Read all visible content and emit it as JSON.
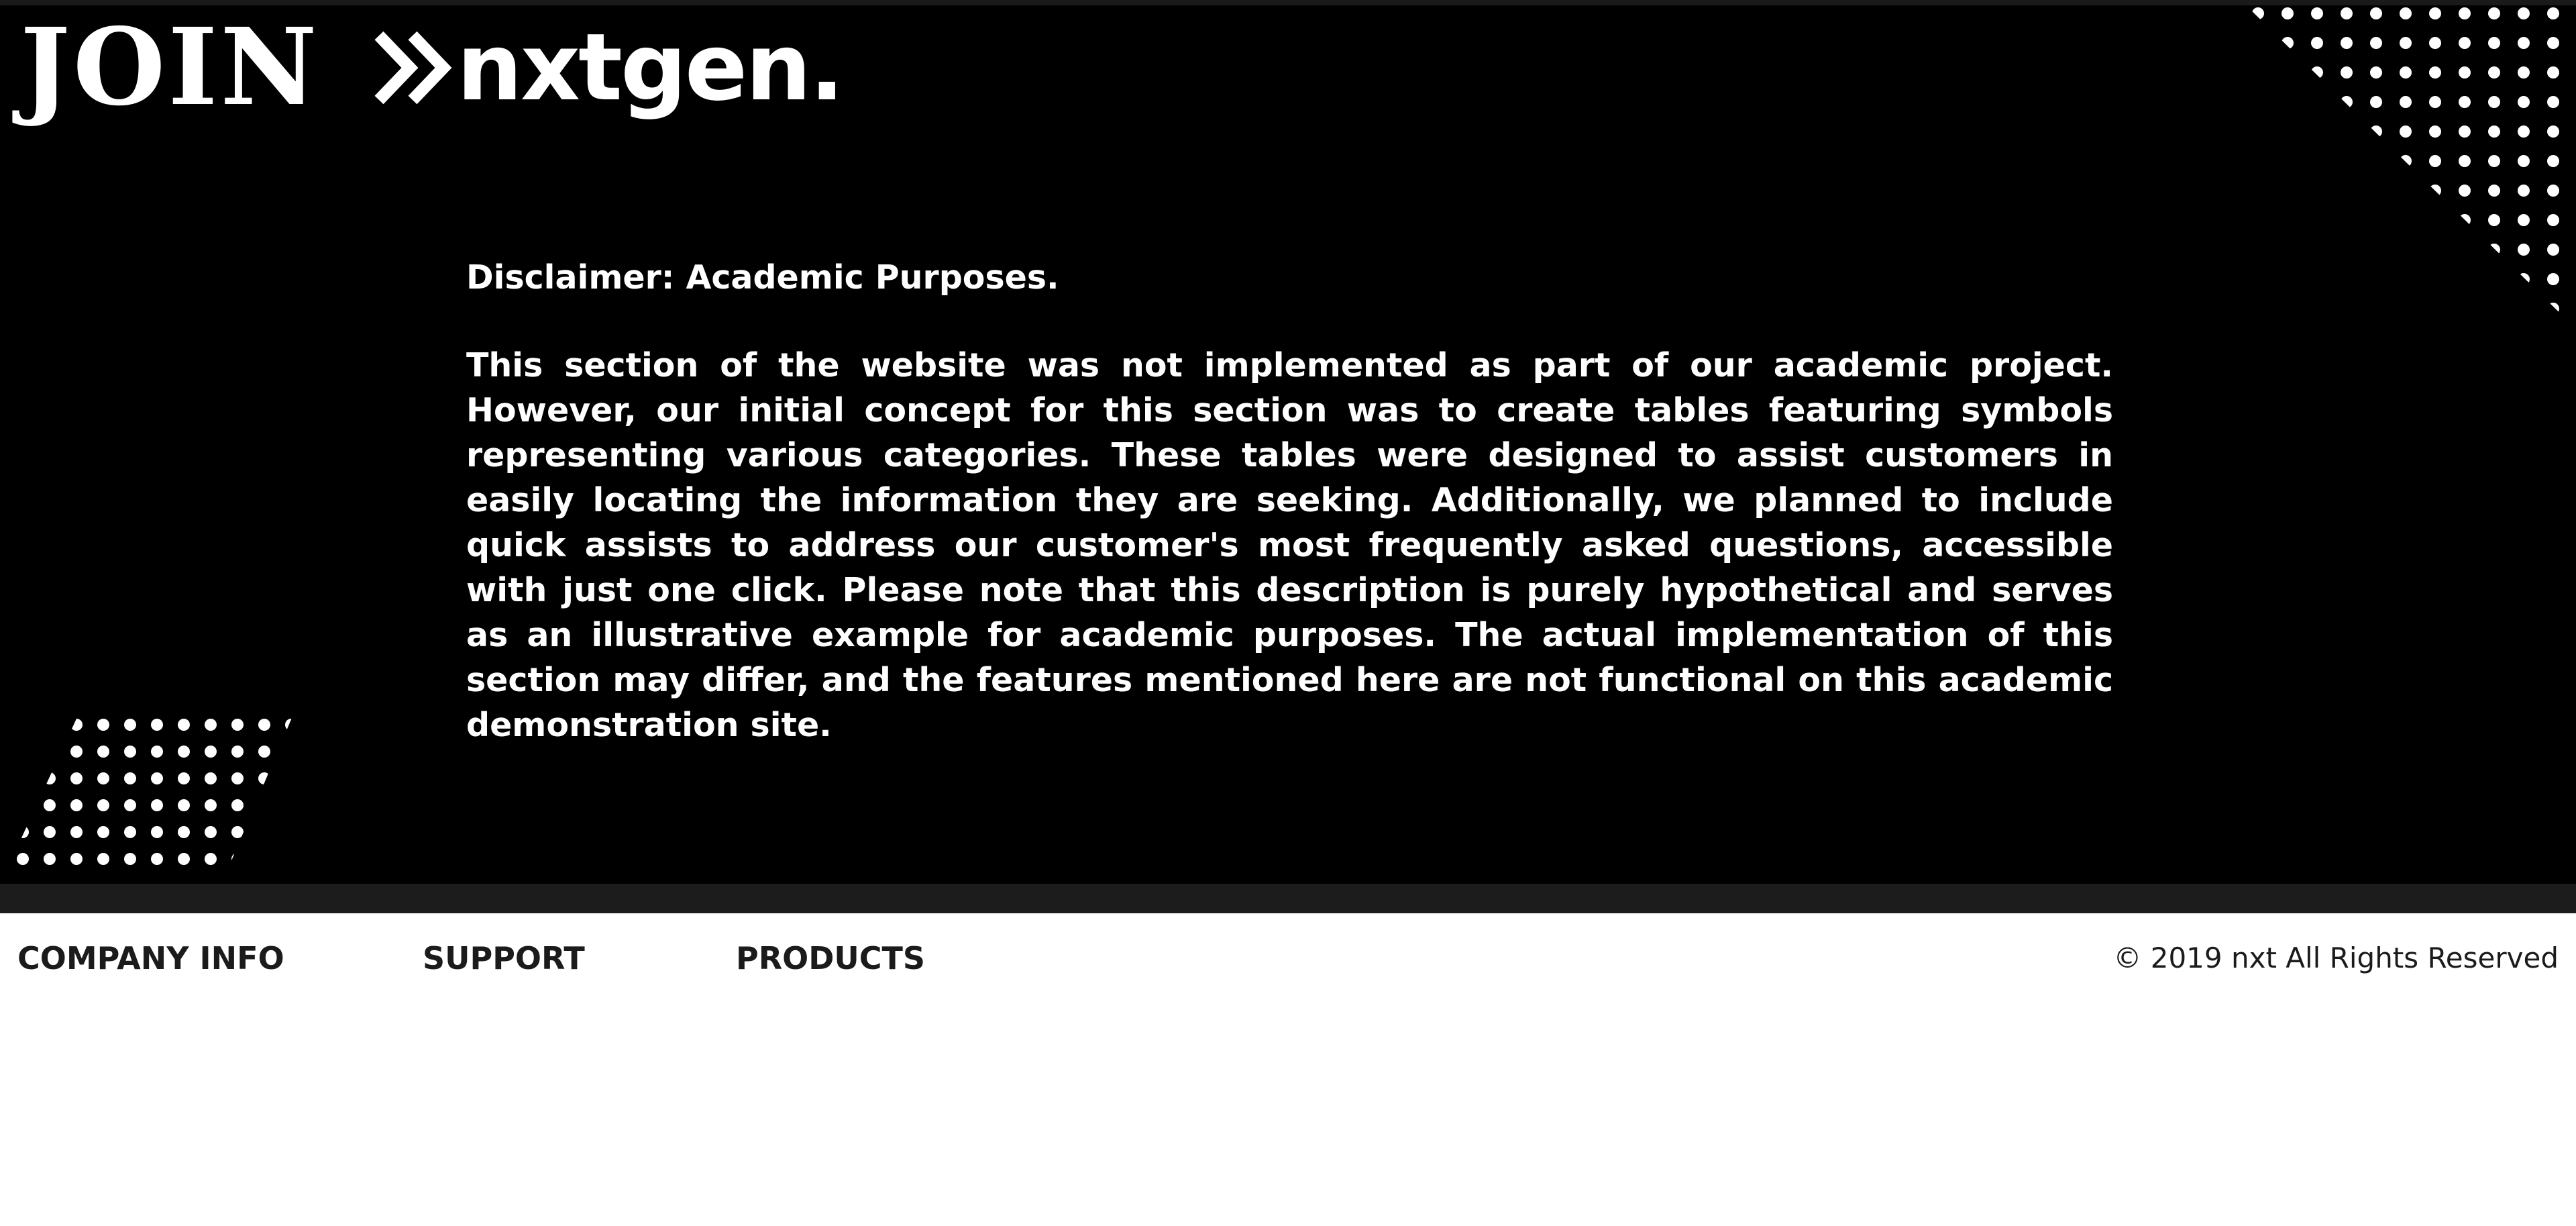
{
  "brand": {
    "join_text": "JOIN",
    "name": "nxtgen.",
    "chevrons_icon": "double-chevron-right-icon"
  },
  "disclaimer": {
    "title": "Disclaimer: Academic Purposes.",
    "body": "This section of the website was not implemented as part of our academic project. However, our initial concept for this section was to create tables featuring symbols representing various categories. These tables were designed to assist customers in easily locating the information they are seeking. Additionally, we planned to include quick assists to address our customer's most frequently asked questions, accessible with just one click. Please note that this description is purely hypothetical and serves as an illustrative example for academic purposes. The actual implementation of this section may differ, and the features mentioned here are not functional on this academic demonstration site."
  },
  "footer": {
    "links": [
      "COMPANY INFO",
      "SUPPORT",
      "PRODUCTS"
    ],
    "copyright": "© 2019 nxt All Rights Reserved"
  },
  "colors": {
    "background": "#000000",
    "text_on_dark": "#ffffff",
    "footer_band": "#1c1c1c",
    "footer_text": "#1b1b1b"
  }
}
